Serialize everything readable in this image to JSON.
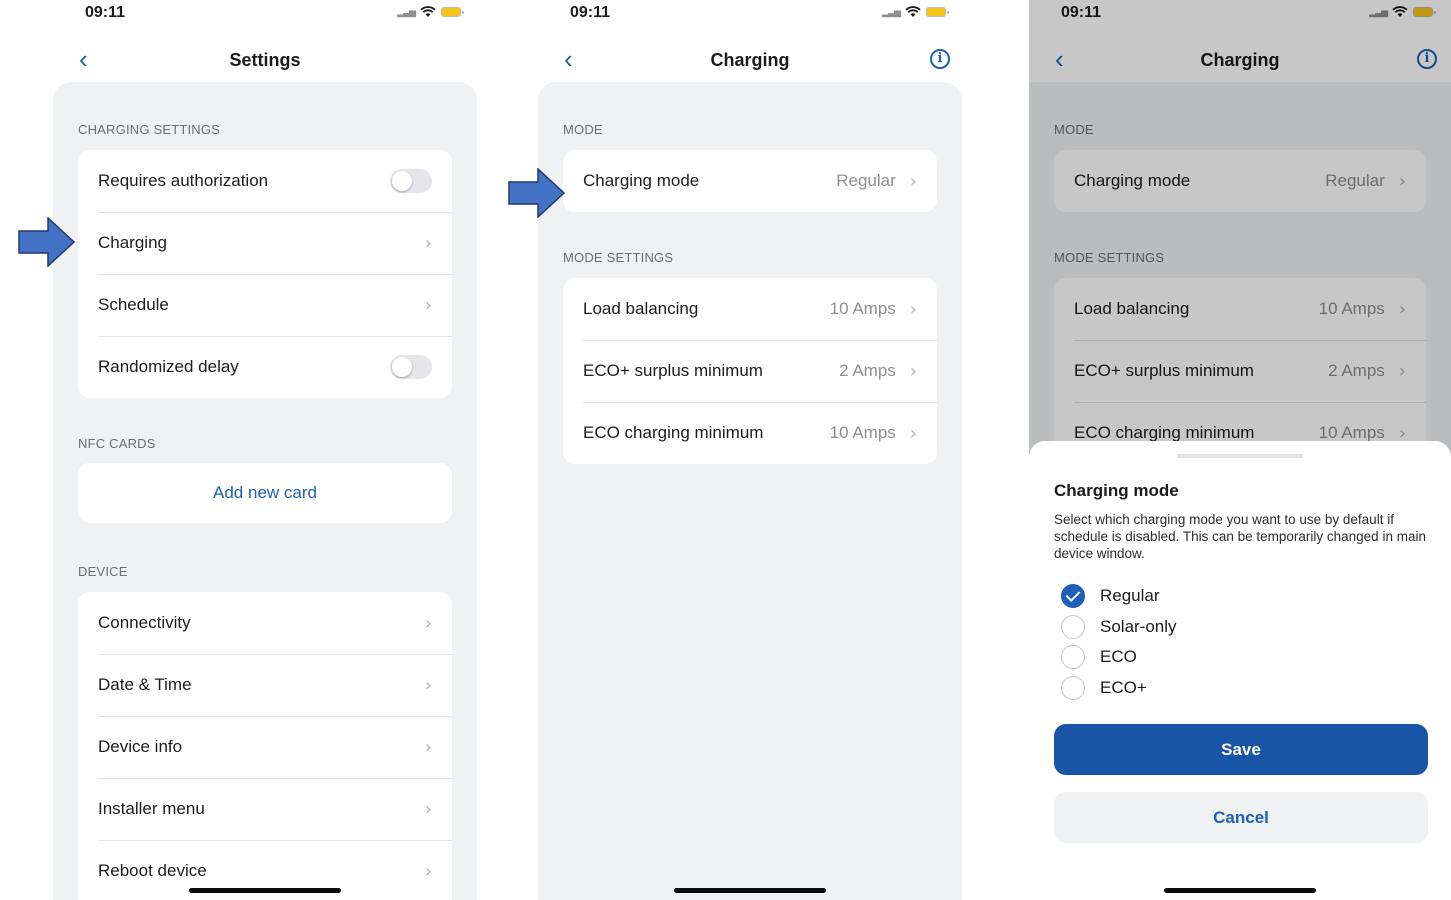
{
  "status_bar": {
    "time": "09:11"
  },
  "settings_screen": {
    "title": "Settings",
    "charging_settings_header": "CHARGING SETTINGS",
    "charging_settings": [
      {
        "label": "Requires authorization",
        "control": "toggle",
        "on": false
      },
      {
        "label": "Charging",
        "control": "chevron"
      },
      {
        "label": "Schedule",
        "control": "chevron"
      },
      {
        "label": "Randomized delay",
        "control": "toggle",
        "on": false
      }
    ],
    "nfc_header": "NFC CARDS",
    "add_card_label": "Add new card",
    "device_header": "DEVICE",
    "device_items": [
      {
        "label": "Connectivity"
      },
      {
        "label": "Date & Time"
      },
      {
        "label": "Device info"
      },
      {
        "label": "Installer menu"
      },
      {
        "label": "Reboot device"
      }
    ]
  },
  "charging_screen": {
    "title": "Charging",
    "mode_header": "MODE",
    "charging_mode": {
      "label": "Charging mode",
      "value": "Regular"
    },
    "mode_settings_header": "MODE SETTINGS",
    "mode_settings": [
      {
        "label": "Load balancing",
        "value": "10 Amps"
      },
      {
        "label": "ECO+ surplus minimum",
        "value": "2 Amps"
      },
      {
        "label": "ECO charging minimum",
        "value": "10 Amps"
      }
    ]
  },
  "charging_mode_sheet": {
    "title": "Charging mode",
    "description": "Select which charging mode you want to use by default if schedule is disabled. This can be temporarily changed in main device window.",
    "options": [
      {
        "label": "Regular",
        "selected": true
      },
      {
        "label": "Solar-only",
        "selected": false
      },
      {
        "label": "ECO",
        "selected": false
      },
      {
        "label": "ECO+",
        "selected": false
      }
    ],
    "save_label": "Save",
    "cancel_label": "Cancel"
  },
  "icons": {
    "back": "chevron-left-icon",
    "info": "info-circle-icon",
    "row_chevron": "chevron-right-icon",
    "annotation": "arrow-right-icon"
  },
  "colors": {
    "accent": "#1f5fb7",
    "save_button": "#1a54a6",
    "annotation_arrow": "#4472c4",
    "panel_background": "#f0f1f3"
  }
}
